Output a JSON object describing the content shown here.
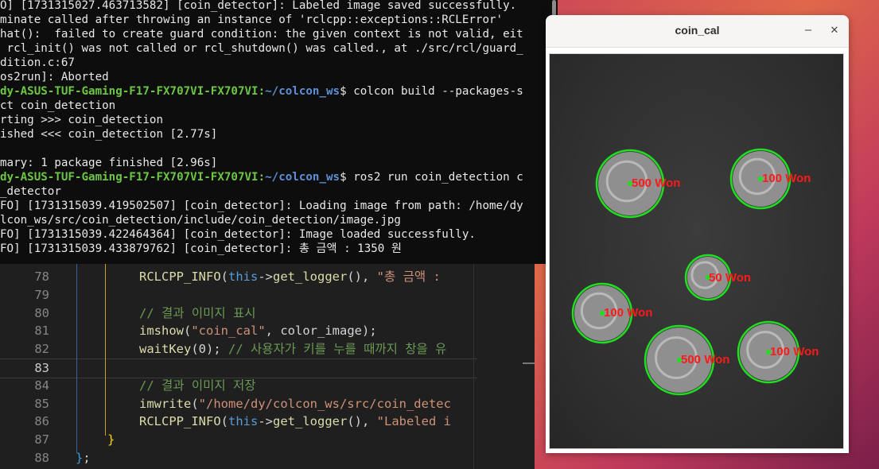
{
  "terminal": {
    "lines": [
      {
        "text": "O] [1731315027.463713582] [coin_detector]: Labeled image saved successfully."
      },
      {
        "text": "minate called after throwing an instance of 'rclcpp::exceptions::RCLError'"
      },
      {
        "text": "hat():  failed to create guard condition: the given context is not valid, eit"
      },
      {
        "text": " rcl_init() was not called or rcl_shutdown() was called., at ./src/rcl/guard_"
      },
      {
        "text": "dition.c:67"
      },
      {
        "text": "os2run]: Aborted"
      },
      {
        "host": "dy-ASUS-TUF-Gaming-F17-FX707VI-FX707VI",
        "path": "~/colcon_ws",
        "cmd": "$ colcon build --packages-s"
      },
      {
        "text": "ct coin_detection"
      },
      {
        "text": "rting >>> coin_detection"
      },
      {
        "text": "ished <<< coin_detection [2.77s]"
      },
      {
        "text": ""
      },
      {
        "text": "mary: 1 package finished [2.96s]"
      },
      {
        "host": "dy-ASUS-TUF-Gaming-F17-FX707VI-FX707VI",
        "path": "~/colcon_ws",
        "cmd": "$ ros2 run coin_detection c"
      },
      {
        "text": "_detector"
      },
      {
        "text": "FO] [1731315039.419502507] [coin_detector]: Loading image from path: /home/dy"
      },
      {
        "text": "lcon_ws/src/coin_detection/include/coin_detection/image.jpg"
      },
      {
        "text": "FO] [1731315039.422464364] [coin_detector]: Image loaded successfully."
      },
      {
        "text": "FO] [1731315039.433879762] [coin_detector]: 총 금액 : 1350 원"
      }
    ]
  },
  "editor": {
    "lines": [
      {
        "num": "78",
        "tokens": [
          {
            "t": "RCLCPP_INFO",
            "c": "fn"
          },
          {
            "t": "(",
            "c": "paren"
          },
          {
            "t": "this",
            "c": "kw"
          },
          {
            "t": "->",
            "c": "txt"
          },
          {
            "t": "get_logger",
            "c": "fn"
          },
          {
            "t": "()",
            "c": "paren"
          },
          {
            "t": ", ",
            "c": "txt"
          },
          {
            "t": "\"총 금액 : ",
            "c": "str"
          }
        ]
      },
      {
        "num": "79",
        "tokens": []
      },
      {
        "num": "80",
        "tokens": [
          {
            "t": "// 결과 이미지 표시",
            "c": "cm"
          }
        ]
      },
      {
        "num": "81",
        "tokens": [
          {
            "t": "imshow",
            "c": "fn"
          },
          {
            "t": "(",
            "c": "paren"
          },
          {
            "t": "\"coin_cal\"",
            "c": "str"
          },
          {
            "t": ", ",
            "c": "txt"
          },
          {
            "t": "color_image",
            "c": "txt"
          },
          {
            "t": ");",
            "c": "txt"
          }
        ]
      },
      {
        "num": "82",
        "tokens": [
          {
            "t": "waitKey",
            "c": "fn"
          },
          {
            "t": "(",
            "c": "paren"
          },
          {
            "t": "0",
            "c": "txt"
          },
          {
            "t": "); ",
            "c": "txt"
          },
          {
            "t": "// 사용자가 키를 누를 때까지 창을 유",
            "c": "cm"
          }
        ]
      },
      {
        "num": "83",
        "tokens": []
      },
      {
        "num": "84",
        "tokens": [
          {
            "t": "// 결과 이미지 저장",
            "c": "cm"
          }
        ]
      },
      {
        "num": "85",
        "tokens": [
          {
            "t": "imwrite",
            "c": "fn"
          },
          {
            "t": "(",
            "c": "paren"
          },
          {
            "t": "\"/home/dy/colcon_ws/src/coin_detec",
            "c": "str"
          }
        ]
      },
      {
        "num": "86",
        "tokens": [
          {
            "t": "RCLCPP_INFO",
            "c": "fn"
          },
          {
            "t": "(",
            "c": "paren"
          },
          {
            "t": "this",
            "c": "kw"
          },
          {
            "t": "->",
            "c": "txt"
          },
          {
            "t": "get_logger",
            "c": "fn"
          },
          {
            "t": "()",
            "c": "paren"
          },
          {
            "t": ", ",
            "c": "txt"
          },
          {
            "t": "\"Labeled i",
            "c": "str"
          }
        ]
      },
      {
        "num": "87",
        "tokens": [
          {
            "t": "}",
            "c": "brace-g"
          }
        ]
      },
      {
        "num": "88",
        "tokens": [
          {
            "t": "}",
            "c": "brace-m"
          },
          {
            "t": ";",
            "c": "txt"
          }
        ]
      }
    ]
  },
  "coin_window": {
    "title": "coin_cal",
    "minimize_glyph": "–",
    "close_glyph": "✕",
    "coins": [
      {
        "label": "500 Won"
      },
      {
        "label": "100 Won"
      },
      {
        "label": "50 Won"
      },
      {
        "label": "100 Won"
      },
      {
        "label": "500 Won"
      },
      {
        "label": "100 Won"
      }
    ],
    "circle_color": "#1fe01f",
    "label_color": "#ff1a1a"
  },
  "colors": {
    "terminal_bg": "#0d0d0d",
    "editor_bg": "#1f1f1f",
    "prompt_host": "#6cc644",
    "prompt_path": "#5f8fd6"
  }
}
